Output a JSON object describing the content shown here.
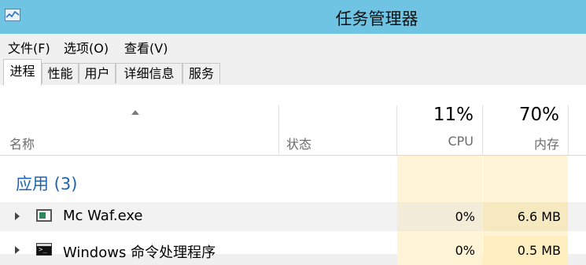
{
  "window": {
    "title": "任务管理器"
  },
  "menu": [
    "文件(F)",
    "选项(O)",
    "查看(V)"
  ],
  "tabs": [
    "进程",
    "性能",
    "用户",
    "详细信息",
    "服务"
  ],
  "active_tab": "进程",
  "columns": {
    "name": "名称",
    "status": "状态",
    "cpu_label": "CPU",
    "cpu_total": "11%",
    "mem_label": "内存",
    "mem_total": "70%"
  },
  "group": {
    "title": "应用 (3)"
  },
  "rows": [
    {
      "name": "Mc Waf.exe",
      "cpu": "0%",
      "memory": "6.6 MB",
      "icon": "app-window-icon"
    },
    {
      "name": "Windows 命令处理程序",
      "cpu": "0%",
      "memory": "0.5 MB",
      "icon": "cmd-console-icon"
    }
  ],
  "colors": {
    "titlebar": "#6fc4e3",
    "group_title": "#1f63b3",
    "column_tint_light": "#fff4d6",
    "column_tint_strong": "#ffefc0"
  }
}
